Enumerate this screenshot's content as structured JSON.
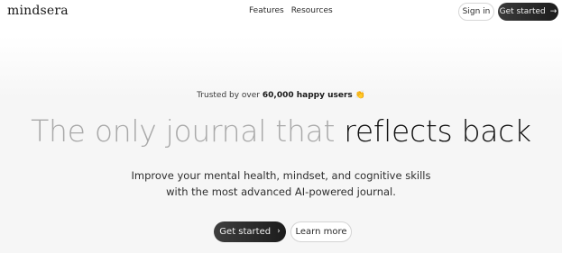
{
  "nav": {
    "logo": "mindsera",
    "links": [
      "Features",
      "Resources"
    ],
    "signin_label": "Sign in",
    "get_started_label": "Get started"
  },
  "hero": {
    "trusted_prefix": "Trusted by over",
    "trusted_count": "60,000 happy users",
    "trusted_emoji": "👏",
    "headline_light": "The only journal that",
    "headline_dark": "reflects back",
    "subtext": "Improve your mental health, mindset, and cognitive skills with the most advanced AI-powered journal.",
    "cta_primary": "Get started",
    "cta_secondary": "Learn more"
  },
  "icons": {
    "top_cta": "arrow-right-icon",
    "hero_cta": "chevron-right-icon"
  },
  "colors": {
    "primary_button": "#1c1c1c",
    "headline_light": "#a9a9a9",
    "headline_dark": "#111111"
  }
}
